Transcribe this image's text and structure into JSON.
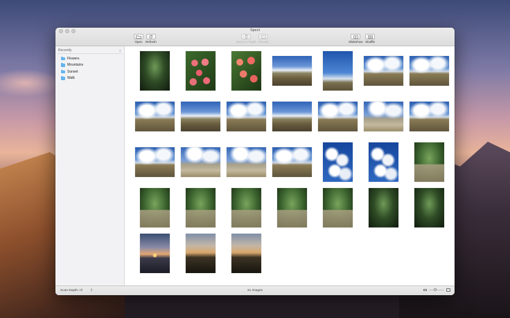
{
  "window": {
    "title": "Spect"
  },
  "toolbar": {
    "open_label": "Open",
    "refresh_label": "Refresh",
    "move_to_trash_label": "Move to Trash",
    "reveal_label": "Reveal",
    "slideshow_label": "Slideshow",
    "shuffle_label": "Shuffle"
  },
  "sidebar": {
    "dropdown_value": "Recently",
    "items": [
      {
        "label": "Flowers",
        "icon": "folder-icon"
      },
      {
        "label": "Mountains",
        "icon": "folder-icon"
      },
      {
        "label": "Sunset",
        "icon": "folder-icon"
      },
      {
        "label": "Walk",
        "icon": "folder-icon"
      }
    ]
  },
  "gallery": {
    "photos": [
      {
        "kind": "forest"
      },
      {
        "kind": "flowers"
      },
      {
        "kind": "flowers2"
      },
      {
        "kind": "mtn"
      },
      {
        "kind": "mtn-sky"
      },
      {
        "kind": "clouds"
      },
      {
        "kind": "clouds"
      },
      {
        "kind": "clouds"
      },
      {
        "kind": "mtn"
      },
      {
        "kind": "clouds"
      },
      {
        "kind": "mtn"
      },
      {
        "kind": "clouds"
      },
      {
        "kind": "clouds-road"
      },
      {
        "kind": "clouds"
      },
      {
        "kind": "clouds"
      },
      {
        "kind": "clouds-road"
      },
      {
        "kind": "clouds-road"
      },
      {
        "kind": "clouds"
      },
      {
        "kind": "cumulus"
      },
      {
        "kind": "cumulus"
      },
      {
        "kind": "stairs"
      },
      {
        "kind": "stairs"
      },
      {
        "kind": "stairs"
      },
      {
        "kind": "stairs"
      },
      {
        "kind": "stairs"
      },
      {
        "kind": "stairs"
      },
      {
        "kind": "forest"
      },
      {
        "kind": "forest"
      },
      {
        "kind": "sunset"
      },
      {
        "kind": "grass"
      },
      {
        "kind": "grass"
      }
    ]
  },
  "statusbar": {
    "scan_depth_label": "Scan Depth:",
    "scan_depth_value": "All",
    "image_count": "31 images"
  }
}
